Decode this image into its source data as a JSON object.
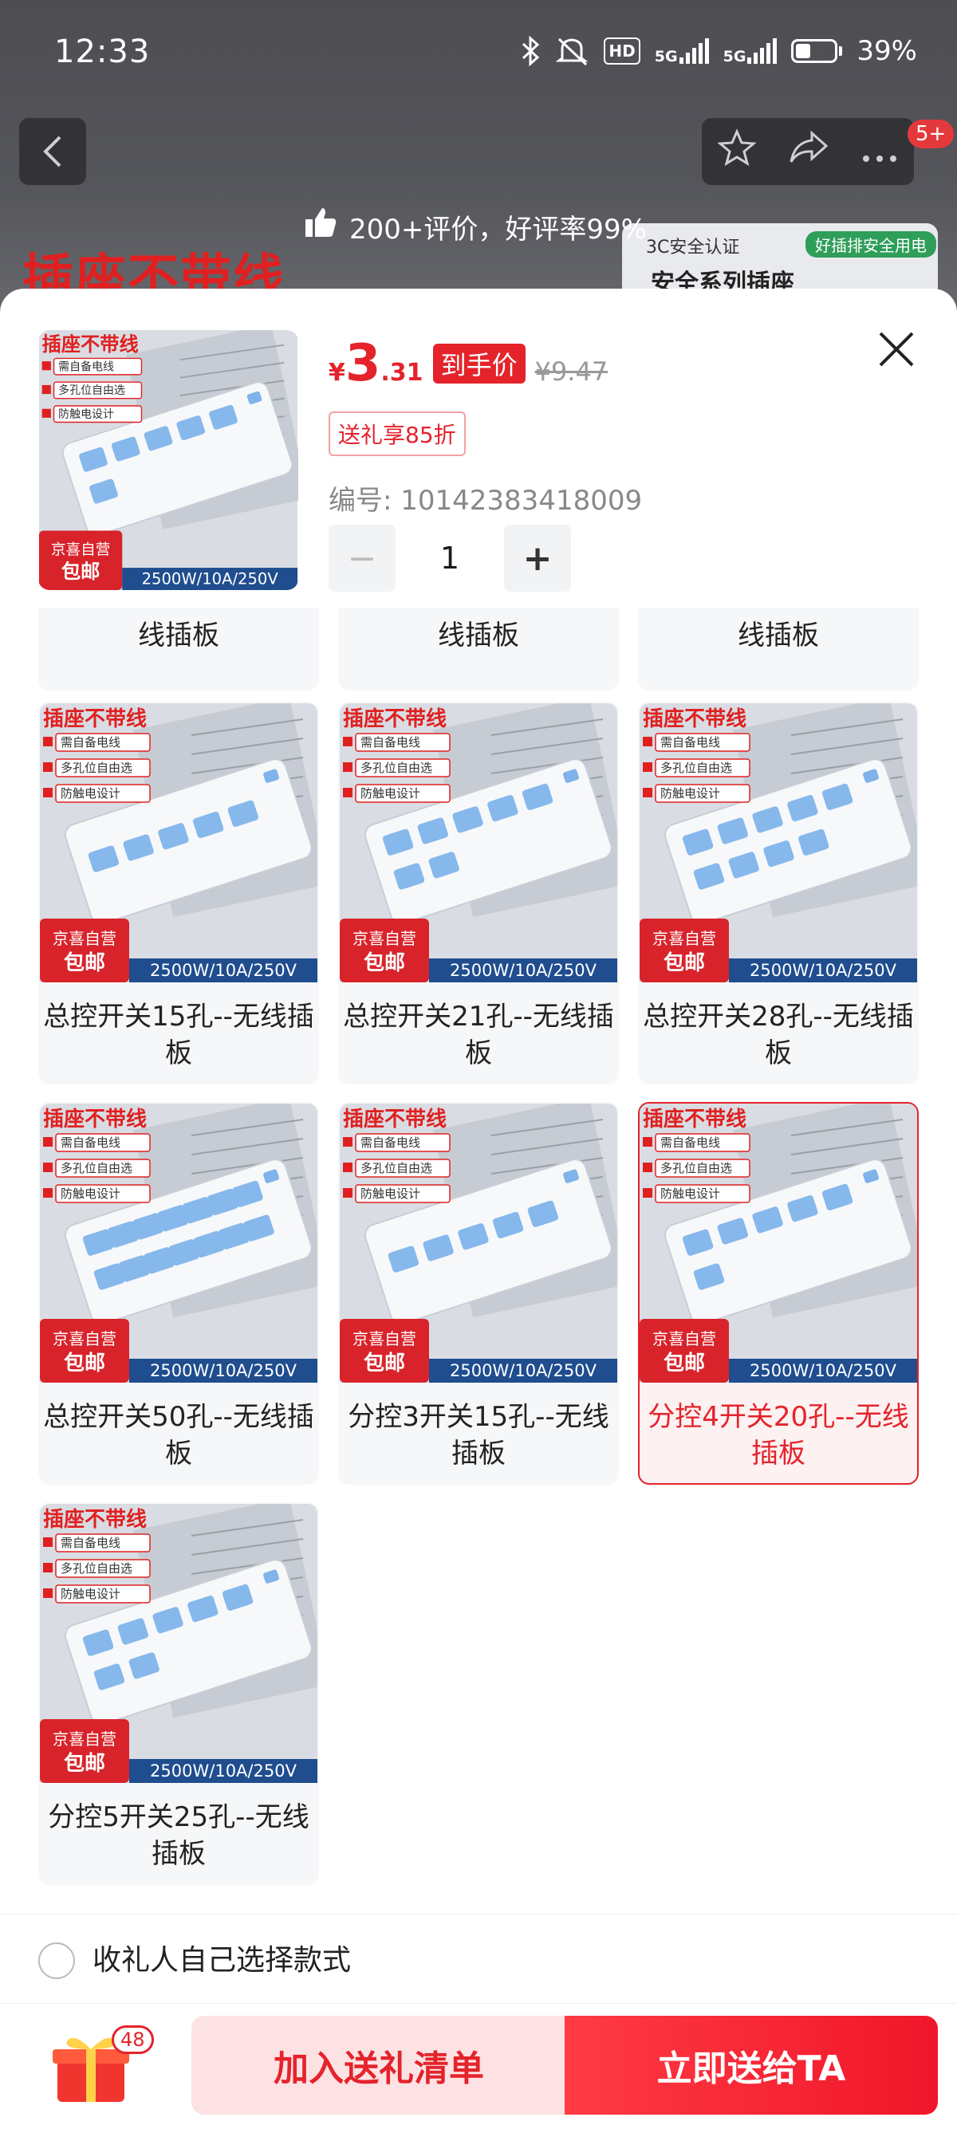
{
  "status_bar": {
    "time": "12:33",
    "battery": "39%",
    "net1": "5G",
    "net2": "5G",
    "hd": "HD"
  },
  "top_nav": {
    "back_icon": "chevron-left-icon",
    "badge": "5+"
  },
  "review_banner": {
    "text": "200+评价，好评率99%"
  },
  "background": {
    "headline": "插座不带线",
    "card_cert": "3C安全认证",
    "card_tag": "好插排安全用电",
    "card_title": "安全系列插座"
  },
  "product": {
    "price_symbol": "¥",
    "price_int": "3",
    "price_dec": ".31",
    "price_tag": "到手价",
    "original_price": "¥9.47",
    "gift_discount": "送礼享85折",
    "sku_number": "编号: 10142383418009",
    "quantity": "1",
    "minus": "−",
    "plus": "+"
  },
  "thumb_text": {
    "headline": "插座不带线",
    "feature1": "需自备电线",
    "feature2": "多孔位自由选",
    "feature3": "防触电设计",
    "jd_line1": "京喜自营",
    "jd_line2": "包邮",
    "spec": "2500W/10A/250V"
  },
  "variants": [
    {
      "label": "线插板",
      "selected": false
    },
    {
      "label": "线插板",
      "selected": false
    },
    {
      "label": "线插板",
      "selected": false
    },
    {
      "label": "总控开关15孔--无线插板",
      "selected": false,
      "sockets": 5
    },
    {
      "label": "总控开关21孔--无线插板",
      "selected": false,
      "sockets": 7
    },
    {
      "label": "总控开关28孔--无线插板",
      "selected": false,
      "sockets": 9
    },
    {
      "label": "总控开关50孔--无线插板",
      "selected": false,
      "sockets": 14
    },
    {
      "label": "分控3开关15孔--无线插板",
      "selected": false,
      "sockets": 5
    },
    {
      "label": "分控4开关20孔--无线插板",
      "selected": true,
      "sockets": 6
    },
    {
      "label": "分控5开关25孔--无线插板",
      "selected": false,
      "sockets": 7
    }
  ],
  "recipient_choice": {
    "label": "收礼人自己选择款式"
  },
  "bottom_bar": {
    "cart_count": "48",
    "add_label": "加入送礼清单",
    "send_label": "立即送给TA"
  },
  "colors": {
    "accent": "#e4232b",
    "selected_bg": "#fdf1f1"
  }
}
